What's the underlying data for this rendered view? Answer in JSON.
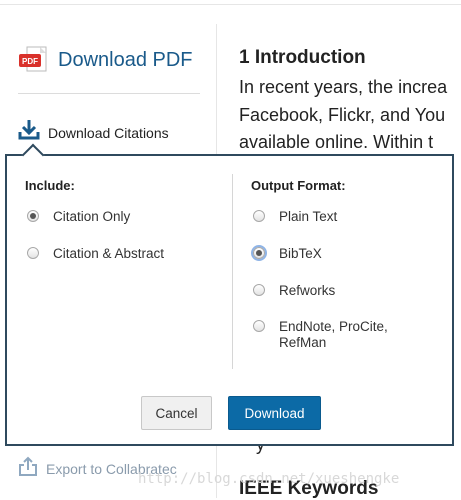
{
  "sidebar": {
    "download_pdf": "Download PDF",
    "download_citations": "Download Citations",
    "export_collabratec": "Export to Collabratec"
  },
  "article": {
    "heading": "1 Introduction",
    "lines": [
      "In recent years, the increa",
      "Facebook, Flickr, and You",
      "available online. Within t"
    ],
    "partial": "y",
    "keywords_heading": "IEEE Keywords"
  },
  "popup": {
    "include_title": "Include:",
    "include_options": [
      "Citation Only",
      "Citation & Abstract"
    ],
    "include_selected": "Citation Only",
    "format_title": "Output Format:",
    "format_options": [
      "Plain Text",
      "BibTeX",
      "Refworks",
      "EndNote, ProCite, RefMan"
    ],
    "format_selected": "BibTeX",
    "cancel_label": "Cancel",
    "download_label": "Download"
  },
  "watermark": "http://blog.csdn.net/xueshengke",
  "colors": {
    "link_blue": "#1a5a8a",
    "popup_border": "#2f4a5e",
    "download_button": "#0c6aa6",
    "pdf_red": "#d9312b"
  },
  "icons": {
    "pdf": "pdf-icon",
    "citations": "download-icon",
    "collabratec": "export-icon"
  }
}
